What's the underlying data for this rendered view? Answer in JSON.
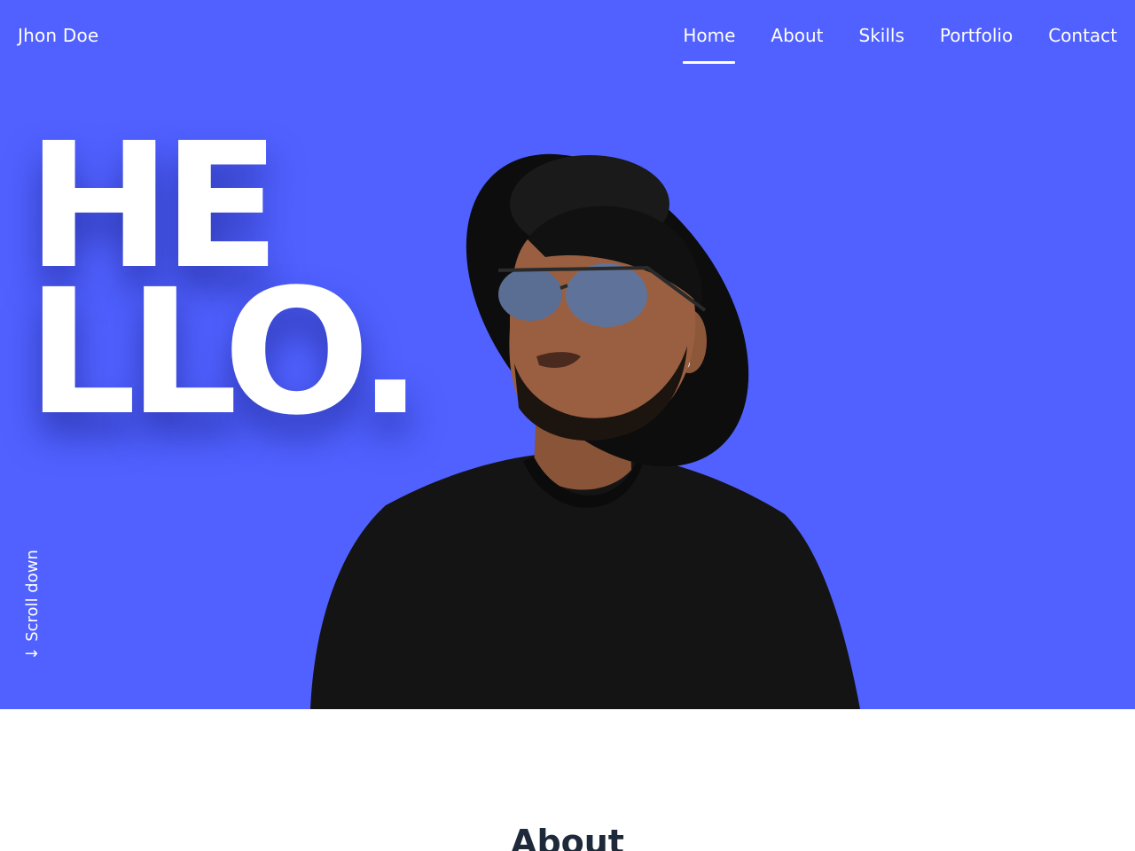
{
  "brand": "Jhon Doe",
  "nav": {
    "home": "Home",
    "about": "About",
    "skills": "Skills",
    "portfolio": "Portfolio",
    "contact": "Contact"
  },
  "hero": {
    "line1": "HE",
    "line2": "LLO.",
    "scroll_label": "Scroll down",
    "scroll_arrow": "↓",
    "background_color": "#5061ff"
  },
  "about": {
    "title": "About"
  }
}
